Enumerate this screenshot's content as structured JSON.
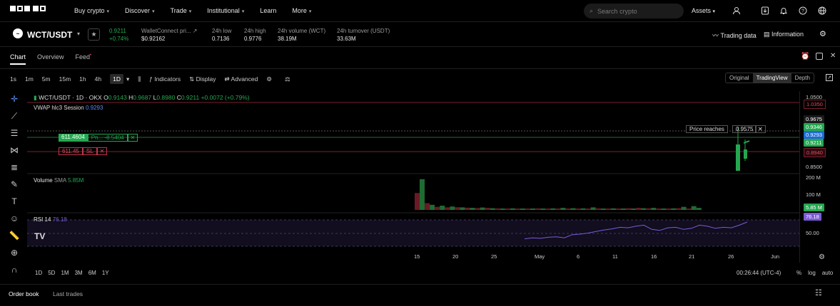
{
  "nav": {
    "items": [
      "Buy crypto",
      "Discover",
      "Trade",
      "Institutional",
      "Learn",
      "More"
    ],
    "search_placeholder": "Search crypto",
    "assets_label": "Assets"
  },
  "ticker": {
    "pair": "WCT/USDT",
    "last_price": "0.9211",
    "change_pct": "+0.74%",
    "project_label": "WalletConnect pri...",
    "usd_price": "$0.92162",
    "low_label": "24h low",
    "low": "0.7136",
    "high_label": "24h high",
    "high": "0.9776",
    "vol_label": "24h volume (WCT)",
    "vol": "38.19M",
    "turnover_label": "24h turnover (USDT)",
    "turnover": "33.63M",
    "trading_data": "Trading data",
    "information": "Information"
  },
  "tabs": {
    "chart": "Chart",
    "overview": "Overview",
    "feed": "Feed"
  },
  "toolbar": {
    "intervals": [
      "1s",
      "1m",
      "5m",
      "15m",
      "1h",
      "4h"
    ],
    "active_interval": "1D",
    "indicators": "Indicators",
    "display": "Display",
    "advanced": "Advanced",
    "modes": [
      "Original",
      "TradingView",
      "Depth"
    ]
  },
  "legend": {
    "title": "WCT/USDT · 1D · OKX",
    "o_label": "O",
    "o": "0.9143",
    "h_label": "H",
    "h": "0.9687",
    "l_label": "L",
    "l": "0.8980",
    "c_label": "C",
    "c": "0.9211",
    "change": "+0.0072 (+0.79%)",
    "vwap_label": "VWAP hlc3 Session",
    "vwap": "0.9293"
  },
  "orders": {
    "tp_value": "611.4604",
    "tp_pnl": "Pn... -8.5404",
    "sl_value": "611.45",
    "sl_label": "SL",
    "close_symbol": "✕",
    "alert_text": "Price reaches",
    "alert_price": "0.9575"
  },
  "volume": {
    "label": "Volume",
    "sma_label": "SMA",
    "sma": "5.85M"
  },
  "rsi": {
    "label": "RSI 14",
    "value": "76.18"
  },
  "yaxis": {
    "labels": [
      "1.0500",
      "1.0350",
      "0.8500",
      "200 M",
      "100 M",
      "50.00"
    ],
    "tags": [
      {
        "text": "0.9675",
        "bg": "#1a1a1a",
        "fg": "#fff"
      },
      {
        "text": "0.9346",
        "bg": "#25a750",
        "fg": "#fff"
      },
      {
        "text": "0.9293",
        "bg": "#1e6ad6",
        "fg": "#fff"
      },
      {
        "text": "0.9211",
        "bg": "#25a750",
        "fg": "#fff"
      },
      {
        "text": "0.8940",
        "bg": "#2a0a10",
        "fg": "#e04b5c"
      },
      {
        "text": "5.85 M",
        "bg": "#25a750",
        "fg": "#fff"
      },
      {
        "text": "76.18",
        "bg": "#7a5cd6",
        "fg": "#fff"
      }
    ]
  },
  "xaxis": {
    "labels": [
      "15",
      "20",
      "25",
      "May",
      "6",
      "11",
      "16",
      "21",
      "26",
      "Jun"
    ]
  },
  "ranges": [
    "1D",
    "5D",
    "1M",
    "3M",
    "6M",
    "1Y"
  ],
  "clock": "00:26:44 (UTC-4)",
  "scale_options": [
    "%",
    "log",
    "auto"
  ],
  "bottom_tabs": {
    "order_book": "Order book",
    "last_trades": "Last trades"
  },
  "colors": {
    "up": "#25a750",
    "down": "#e04b5c",
    "rsi": "#7a5cd6",
    "accent": "#1e6ad6"
  },
  "chart_data": {
    "type": "bar",
    "volume_up": [
      180,
      30,
      25,
      20,
      15,
      12,
      14,
      10,
      8,
      9,
      8,
      7,
      8,
      9,
      12,
      10,
      9,
      15,
      8,
      9,
      7,
      8,
      10,
      12,
      8,
      9,
      18,
      22,
      12
    ],
    "volume_down": [
      40,
      18,
      15,
      16,
      13,
      11,
      12,
      9,
      8,
      7,
      8,
      9,
      8,
      7,
      6,
      8,
      7,
      9,
      8,
      7,
      10,
      12,
      9,
      8,
      7,
      10,
      6
    ],
    "rsi": [
      44,
      46,
      45,
      47,
      48,
      46,
      52,
      53,
      55,
      58,
      61,
      63,
      66,
      65,
      68,
      70,
      62,
      60,
      65,
      66,
      62,
      64,
      70,
      68,
      64,
      66,
      65,
      70,
      76
    ]
  }
}
